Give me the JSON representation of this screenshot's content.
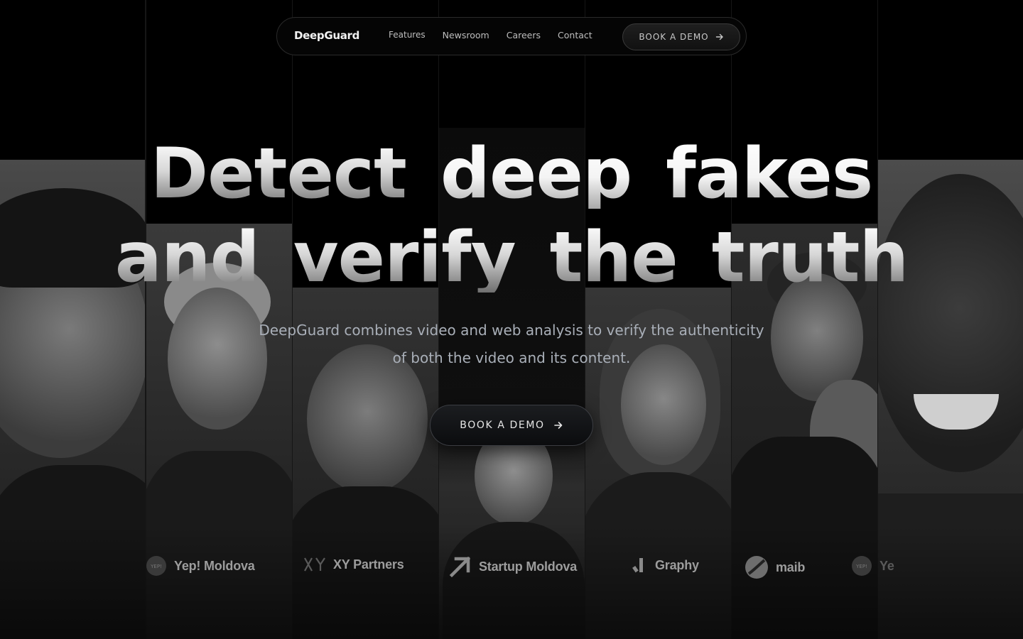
{
  "nav": {
    "brand": "DeepGuard",
    "links": [
      "Features",
      "Newsroom",
      "Careers",
      "Contact"
    ],
    "cta_label": "BOOK A DEMO"
  },
  "hero": {
    "line1": [
      "Detect",
      "deep",
      "fakes"
    ],
    "line2": [
      "and",
      "verify",
      "the",
      "truth"
    ],
    "subtitle_line1": "DeepGuard combines video and web analysis to verify the authenticity",
    "subtitle_line2": "of both the video and its content.",
    "cta_label": "BOOK A DEMO"
  },
  "logos": [
    {
      "name": "Yep! Moldova",
      "icon": "yep-badge-icon"
    },
    {
      "name": "XY Partners",
      "icon": "xy-mark-icon"
    },
    {
      "name": "Startup Moldova",
      "icon": "diagonal-arrow-icon"
    },
    {
      "name": "Graphy",
      "icon": "graphy-mark-icon"
    },
    {
      "name": "maib",
      "icon": "maib-disc-icon"
    },
    {
      "name": "Ye",
      "icon": "yep-badge-icon"
    }
  ],
  "colors": {
    "background": "#000000",
    "text_muted": "#a9afb8",
    "logo_gray": "#9d9d9d",
    "border": "#2a2a2a"
  }
}
